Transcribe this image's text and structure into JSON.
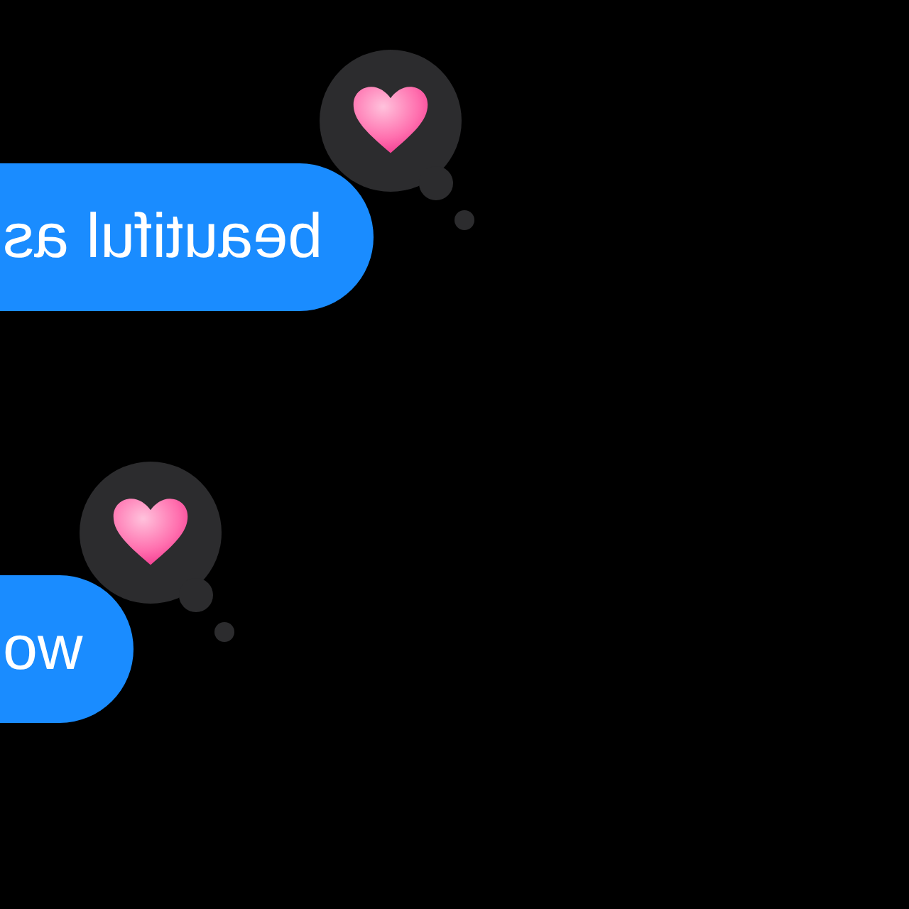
{
  "messages": [
    {
      "text": "beautiful as",
      "reaction": {
        "kind": "heart"
      }
    },
    {
      "text": "wo",
      "reaction": {
        "kind": "heart"
      }
    }
  ]
}
